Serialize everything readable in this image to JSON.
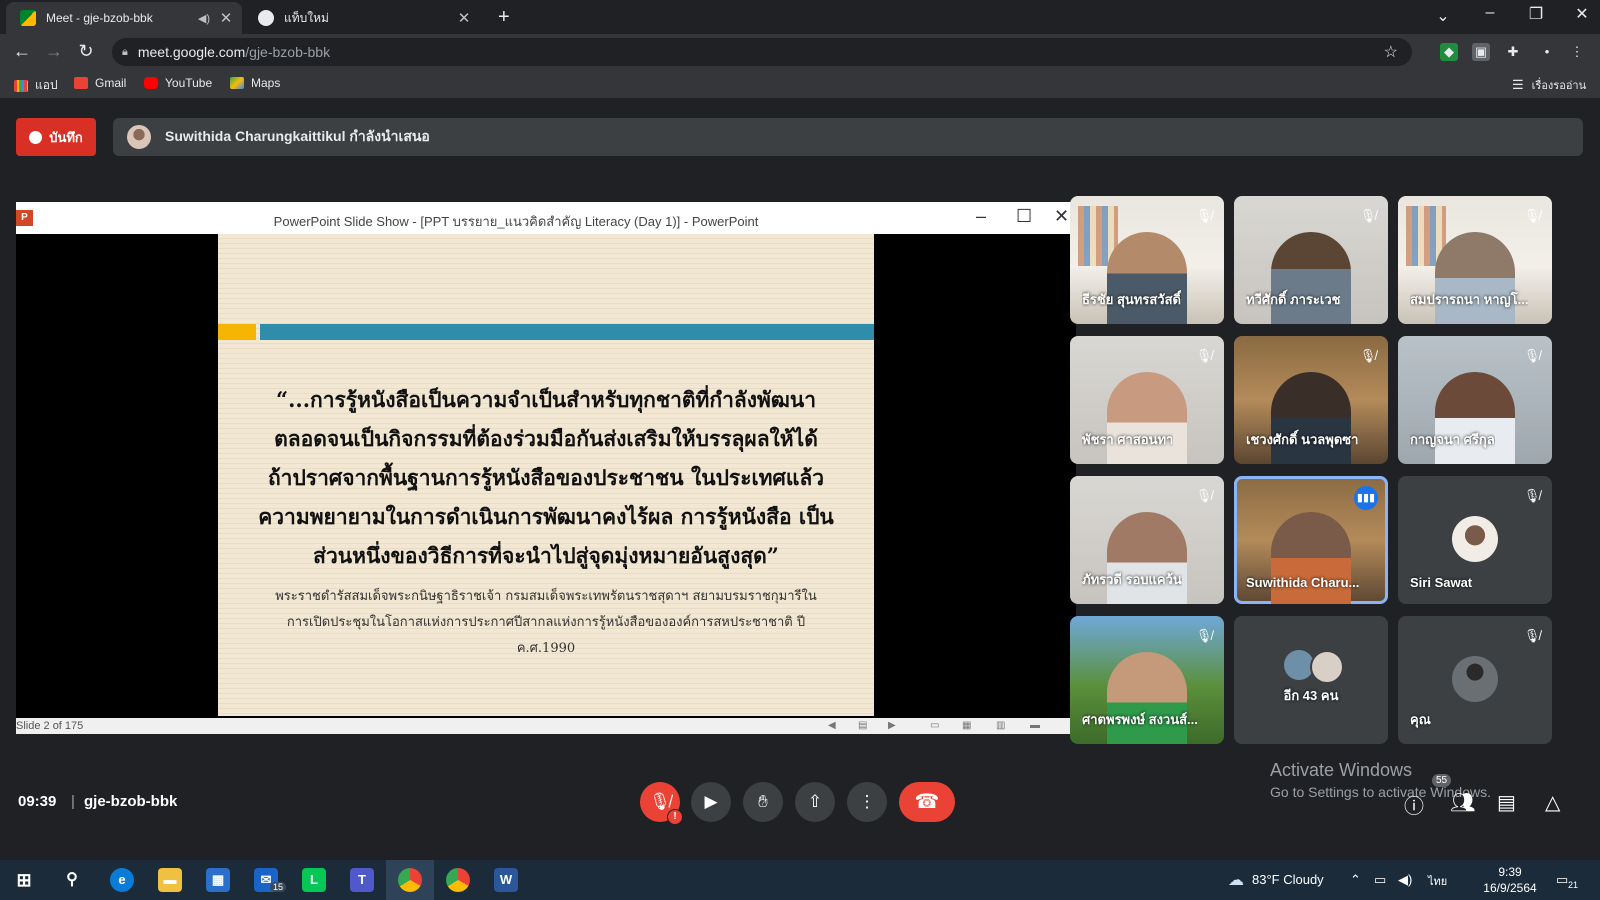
{
  "browser": {
    "tabs": [
      {
        "title": "Meet - gje-bzob-bbk",
        "active": true
      },
      {
        "title": "แท็บใหม่",
        "active": false
      }
    ],
    "url_host": "meet.google.com",
    "url_path": "/gje-bzob-bbk",
    "bookmarks": [
      "แอป",
      "Gmail",
      "YouTube",
      "Maps"
    ],
    "reading_list": "เรื่องรออ่าน"
  },
  "meet": {
    "record_label": "บันทึก",
    "presenter_text": "Suwithida Charungkaittikul กำลังนำเสนอ",
    "meeting_time": "09:39",
    "meeting_code": "gje-bzob-bbk",
    "people_count": "55"
  },
  "powerpoint": {
    "window_title": "PowerPoint Slide Show - [PPT บรรยาย_แนวคิดสำคัญ Literacy (Day 1)] - PowerPoint",
    "status": "Slide 2 of 175",
    "quote_lines": [
      "“...การรู้หนังสือเป็นความจำเป็นสำหรับทุกชาติที่กำลังพัฒนา",
      "ตลอดจนเป็นกิจกรรมที่ต้องร่วมมือกันส่งเสริมให้บรรลุผลให้ได้",
      "ถ้าปราศจากพื้นฐานการรู้หนังสือของประชาชน ในประเทศแล้ว",
      "ความพยายามในการดำเนินการพัฒนาคงไร้ผล การรู้หนังสือ เป็น",
      "ส่วนหนึ่งของวิธีการที่จะนำไปสู่จุดมุ่งหมายอันสูงสุด”"
    ],
    "source_lines": [
      "พระราชดำรัสสมเด็จพระกนิษฐาธิราชเจ้า กรมสมเด็จพระเทพรัตนราชสุดาฯ สยามบรมราชกุมารีใน",
      "การเปิดประชุมในโอกาสแห่งการประกาศปีสากลแห่งการรู้หนังสือขององค์การสหประชาชาติ ปี",
      "ค.ศ.1990"
    ]
  },
  "participants": [
    {
      "name": "ธีรชัย สุนทรสวัสดิ์",
      "muted": true
    },
    {
      "name": "ทวีศักดิ์ ภาระเวช",
      "muted": true
    },
    {
      "name": "สมปรารถนา หาญโ...",
      "muted": true
    },
    {
      "name": "พัชรา ศาสอนทา",
      "muted": true
    },
    {
      "name": "เชวงศักดิ์ นวลพุดซา",
      "muted": true
    },
    {
      "name": "กาญจนา ศรีกุล",
      "muted": true
    },
    {
      "name": "ภัทรวดี รอบแคว้น",
      "muted": true
    },
    {
      "name": "Suwithida Charu...",
      "muted": false
    },
    {
      "name": "Siri Sawat",
      "muted": true
    },
    {
      "name": "ศาตพรพงษ์ สงวนส์...",
      "muted": true
    },
    {
      "name": "อีก 43 คน",
      "muted": false
    },
    {
      "name": "คุณ",
      "muted": true
    }
  ],
  "windows": {
    "activate_title": "Activate Windows",
    "activate_sub": "Go to Settings to activate Windows.",
    "weather": "83°F  Cloudy",
    "lang": "ไทย",
    "time": "9:39",
    "date": "16/9/2564",
    "notif_count": "21",
    "mail_badge": "15"
  },
  "colors": {
    "accent_red": "#ea4335",
    "meet_bg": "#202124",
    "tile_bg": "#3c4043",
    "speaker_blue": "#8ab4f8"
  }
}
